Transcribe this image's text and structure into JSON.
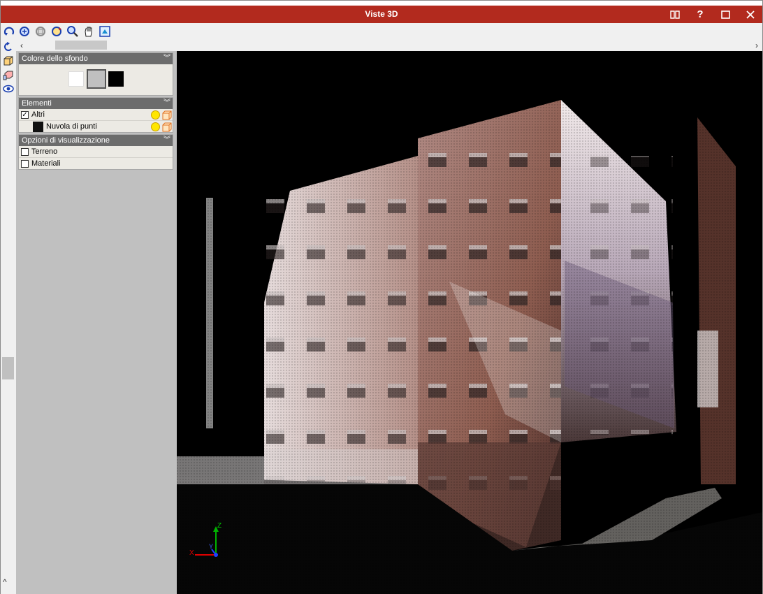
{
  "window": {
    "title": "Viste 3D",
    "title_bar_color": "#b22a1e"
  },
  "title_buttons": [
    {
      "name": "book-icon",
      "glyph": "▯▯"
    },
    {
      "name": "help-icon",
      "glyph": "?"
    },
    {
      "name": "maximize-icon",
      "glyph": "☐"
    },
    {
      "name": "close-icon",
      "glyph": "✕"
    }
  ],
  "toolbar": {
    "tools": [
      "orbit-icon",
      "zoom-extents-icon",
      "zoom-window-icon",
      "rotate-view-icon",
      "zoom-icon",
      "pan-hand-icon",
      "view-options-icon"
    ]
  },
  "left_strip": {
    "icons": [
      "undo-icon",
      "cube-view-icon",
      "cube-layers-icon",
      "eye-icon"
    ]
  },
  "panel": {
    "background_section": {
      "title": "Colore dello sfondo",
      "swatches": [
        {
          "name": "white",
          "color": "#ffffff"
        },
        {
          "name": "gray",
          "color": "#c0c0c0",
          "selected": true
        },
        {
          "name": "black",
          "color": "#000000"
        }
      ]
    },
    "elements_section": {
      "title": "Elementi",
      "items": [
        {
          "label": "Altri",
          "checked": true
        },
        {
          "label": "Nuvola di punti",
          "checked": false
        }
      ]
    },
    "display_section": {
      "title": "Opzioni di visualizzazione",
      "items": [
        {
          "label": "Terreno",
          "checked": false
        },
        {
          "label": "Materiali",
          "checked": false
        }
      ]
    }
  },
  "axes": {
    "x_label": "X",
    "y_label": "Y",
    "z_label": "Z"
  }
}
